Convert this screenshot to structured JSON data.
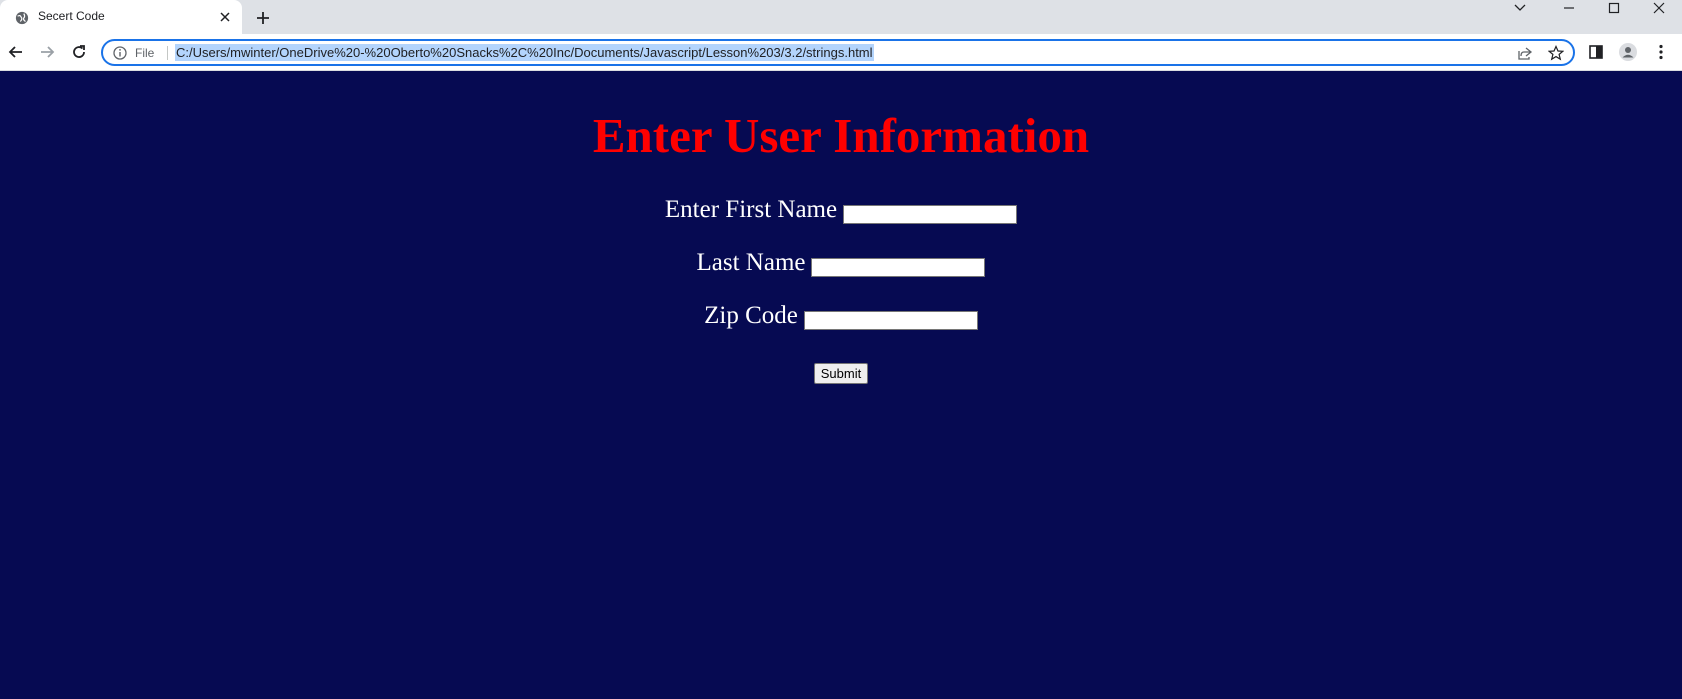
{
  "browser": {
    "tab_title": "Secert Code",
    "site_info_label": "File",
    "url": "C:/Users/mwinter/OneDrive%20-%20Oberto%20Snacks%2C%20Inc/Documents/Javascript/Lesson%203/3.2/strings.html",
    "focus_color": "#1a73e8",
    "selection_color": "#b3d4fc"
  },
  "page": {
    "background_color": "#060a52",
    "heading": "Enter User Information",
    "heading_color": "#ff0000",
    "fields": [
      {
        "label": "Enter First Name",
        "value": ""
      },
      {
        "label": "Last Name",
        "value": ""
      },
      {
        "label": "Zip Code",
        "value": ""
      }
    ],
    "submit_label": "Submit"
  }
}
